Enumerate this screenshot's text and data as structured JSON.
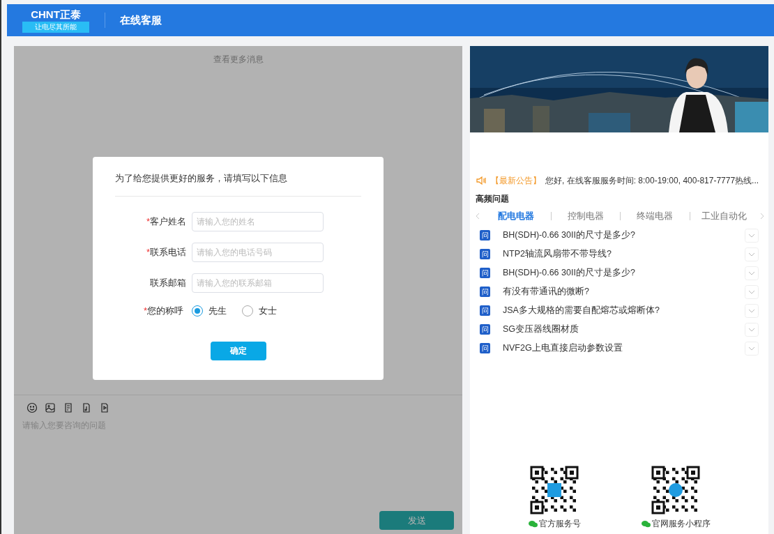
{
  "header": {
    "logo": "CHNT正泰",
    "slogan": "让电尽其所能",
    "title": "在线客服"
  },
  "chat": {
    "more_messages": "查看更多消息",
    "input_placeholder": "请输入您要咨询的问题",
    "send_button": "发送"
  },
  "dialog": {
    "title": "为了给您提供更好的服务，请填写以下信息",
    "fields": [
      {
        "required_mark": "*",
        "label": "客户姓名",
        "placeholder": "请输入您的姓名"
      },
      {
        "required_mark": "*",
        "label": "联系电话",
        "placeholder": "请输入您的电话号码"
      },
      {
        "label": "联系邮箱",
        "placeholder": "请输入您的联系邮箱"
      }
    ],
    "salutation": {
      "required_mark": "*",
      "label": "您的称呼",
      "options": [
        {
          "label": "先生",
          "selected": true
        },
        {
          "label": "女士",
          "selected": false
        }
      ]
    },
    "confirm_button": "确定"
  },
  "announcement": {
    "tag": "【最新公告】",
    "text": "您好, 在线客服服务时间: 8:00-19:00, 400-817-7777热线..."
  },
  "faq": {
    "title": "高频问题",
    "tabs": [
      {
        "label": "配电电器",
        "selected": true
      },
      {
        "label": "控制电器",
        "selected": false
      },
      {
        "label": "终端电器",
        "selected": false
      },
      {
        "label": "工业自动化",
        "selected": false
      }
    ],
    "questions": [
      {
        "badge": "问",
        "text": "BH(SDH)-0.66 30II的尺寸是多少?"
      },
      {
        "badge": "问",
        "text": "NTP2轴流风扇带不带导线?"
      },
      {
        "badge": "问",
        "text": "BH(SDH)-0.66 30II的尺寸是多少?"
      },
      {
        "badge": "问",
        "text": "有没有带通讯的微断?"
      },
      {
        "badge": "问",
        "text": "JSA多大规格的需要自配熔芯或熔断体?"
      },
      {
        "badge": "问",
        "text": "SG变压器线圈材质"
      },
      {
        "badge": "问",
        "text": "NVF2G上电直接启动参数设置"
      }
    ]
  },
  "qr_codes": [
    {
      "label": "官方服务号"
    },
    {
      "label": "官网服务小程序"
    }
  ]
}
